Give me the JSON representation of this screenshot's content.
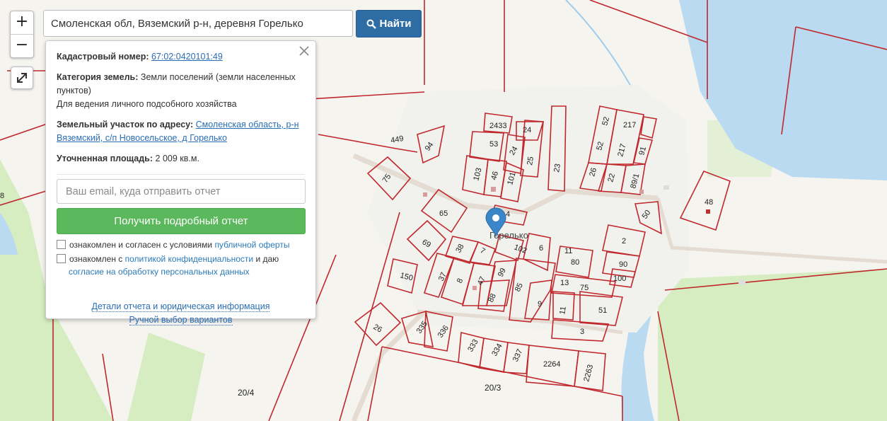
{
  "search": {
    "value": "Смоленская обл, Вяземский р-н, деревня Горелько",
    "button_label": "Найти"
  },
  "zoom": {
    "in_label": "+",
    "out_label": "−"
  },
  "popup": {
    "cadastral_label": "Кадастровый номер:",
    "cadastral_number": "67:02:0420101:49",
    "category_label": "Категория земель:",
    "category_value": "Земли поселений (земли населенных пунктов)",
    "usage_value": "Для ведения личного подсобного хозяйства",
    "address_label": "Земельный участок по адресу:",
    "address_value": "Смоленская область, р-н Вяземский, с/п Новосельское, д Горелько",
    "area_label": "Уточненная площадь:",
    "area_value": "2 009 кв.м.",
    "email_placeholder": "Ваш email, куда отправить отчет",
    "report_button": "Получить подробный отчет",
    "consent1_text": "ознакомлен и согласен с условиями ",
    "consent1_link": "публичной оферты",
    "consent2_text": "ознакомлен с ",
    "consent2_link1": "политикой конфиденциальности",
    "consent2_mid": " и даю",
    "consent2_link2": "согласие на обработку персональных данных",
    "details_link": "Детали отчета и юридическая информация",
    "manual_link": "Ручной выбор вариантов"
  },
  "map": {
    "village_label": "Горелько",
    "plot_numbers": [
      "449",
      "94",
      "2433",
      "24",
      "53",
      "24",
      "25",
      "23",
      "52",
      "217",
      "52",
      "217",
      "91",
      "26",
      "22",
      "89/1",
      "103",
      "46",
      "101",
      "75",
      "65",
      "4",
      "48",
      "50",
      "69",
      "38",
      "7",
      "102",
      "6",
      "2",
      "11",
      "80",
      "90",
      "100",
      "150",
      "37",
      "8",
      "47",
      "99",
      "85",
      "13",
      "75",
      "51",
      "88",
      "9",
      "11",
      "3",
      "26",
      "335",
      "336",
      "333",
      "334",
      "337",
      "2264",
      "2263",
      "20/3",
      "20/4",
      "8"
    ]
  },
  "colors": {
    "plot_border": "#c0282d",
    "water": "#b9daf0",
    "field": "#d6ecc1",
    "button_blue": "#2e6da4",
    "button_green": "#5cb85c",
    "marker": "#3a86c8"
  }
}
